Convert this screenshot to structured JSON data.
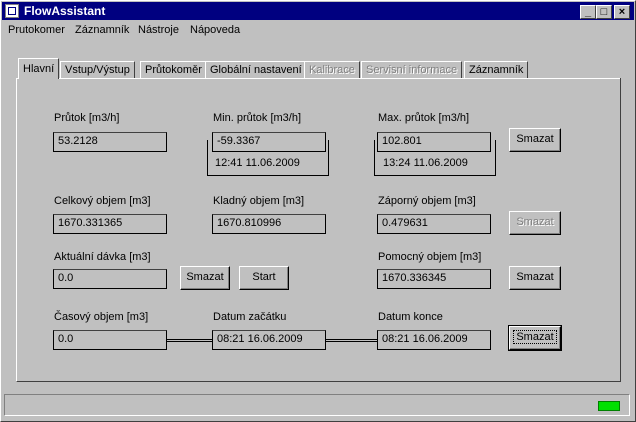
{
  "window": {
    "title": "FlowAssistant"
  },
  "caption_buttons": {
    "minimize": "_",
    "maximize": "□",
    "close": "×"
  },
  "menu": [
    {
      "label": "Prutokomer"
    },
    {
      "label": "Záznamník"
    },
    {
      "label": "Nástroje"
    },
    {
      "label": "Nápoveda"
    }
  ],
  "tabs": [
    {
      "label": "Hlavní",
      "active": true,
      "enabled": true
    },
    {
      "label": "Vstup/Výstup",
      "enabled": true
    },
    {
      "label": "Průtokoměr",
      "enabled": true
    },
    {
      "label": "Globální nastavení",
      "enabled": true
    },
    {
      "label": "Kalibrace",
      "enabled": false
    },
    {
      "label": "Servisní informace",
      "enabled": false
    },
    {
      "label": "Záznamník",
      "enabled": true
    }
  ],
  "main": {
    "flow": {
      "label": "Průtok [m3/h]",
      "value": "53.2128"
    },
    "min_flow": {
      "label": "Min. průtok [m3/h]",
      "value": "-59.3367",
      "time": "12:41 11.06.2009"
    },
    "max_flow": {
      "label": "Max. průtok [m3/h]",
      "value": "102.801",
      "time": "13:24 11.06.2009"
    },
    "total_volume": {
      "label": "Celkový objem [m3]",
      "value": "1670.331365"
    },
    "positive_volume": {
      "label": "Kladný objem [m3]",
      "value": "1670.810996"
    },
    "negative_volume": {
      "label": "Záporný objem [m3]",
      "value": "0.479631"
    },
    "current_dose": {
      "label": "Aktuální dávka [m3]",
      "value": "0.0"
    },
    "aux_volume": {
      "label": "Pomocný objem [m3]",
      "value": "1670.336345"
    },
    "time_volume": {
      "label": "Časový objem [m3]",
      "value": "0.0"
    },
    "start_date": {
      "label": "Datum začátku",
      "value": "08:21 16.06.2009"
    },
    "end_date": {
      "label": "Datum konce",
      "value": "08:21 16.06.2009"
    },
    "buttons": {
      "clear": "Smazat",
      "start": "Start"
    }
  },
  "status": {
    "indicator_color": "#00e000"
  }
}
